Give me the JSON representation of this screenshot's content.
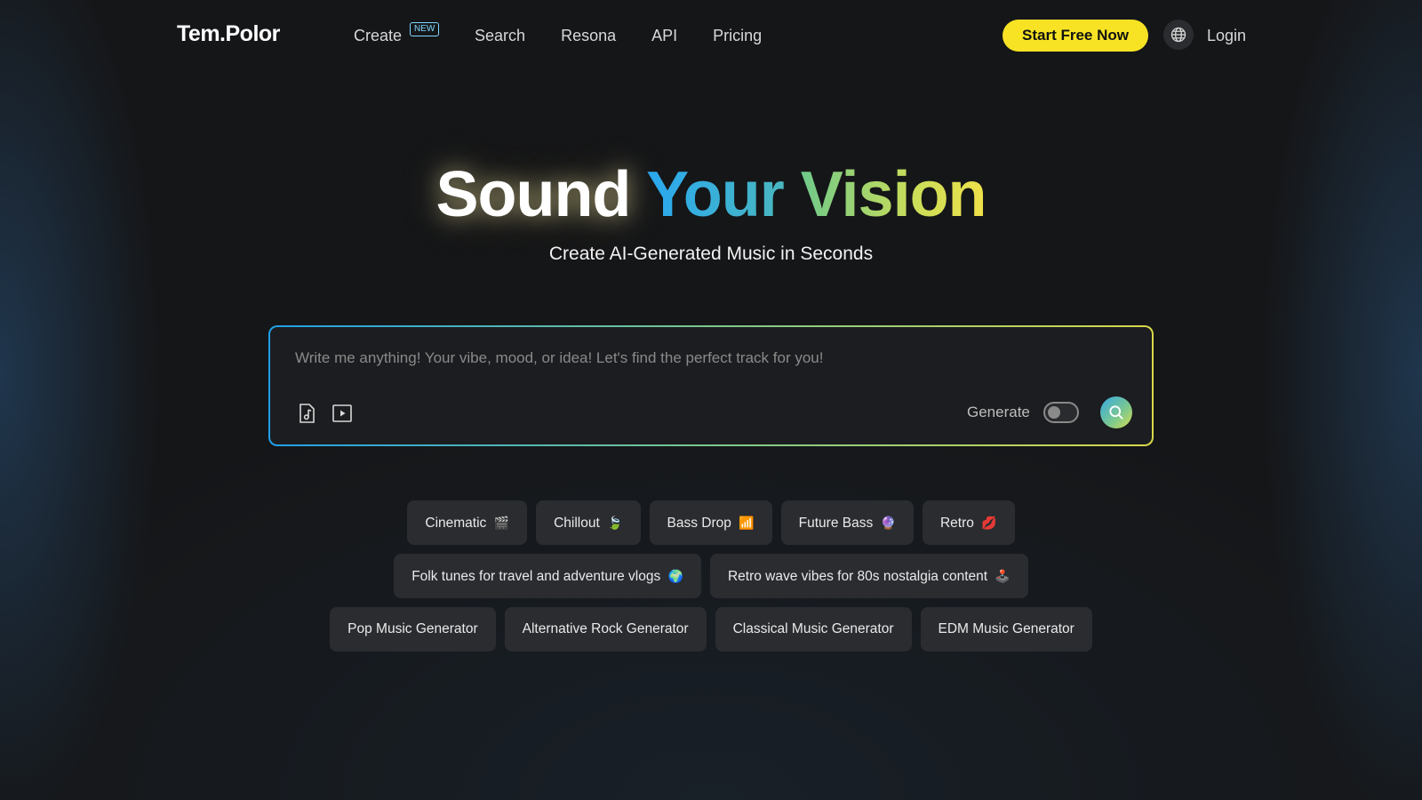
{
  "header": {
    "logo": "Tem.Polor",
    "nav": [
      {
        "label": "Create",
        "badge": "NEW"
      },
      {
        "label": "Search"
      },
      {
        "label": "Resona"
      },
      {
        "label": "API"
      },
      {
        "label": "Pricing"
      }
    ],
    "cta_label": "Start Free Now",
    "globe_icon": "globe-icon",
    "login_label": "Login"
  },
  "hero": {
    "title_words": [
      "Sound",
      "Your",
      "Vision"
    ],
    "subtitle": "Create AI-Generated Music in Seconds"
  },
  "prompt": {
    "placeholder": "Write me anything! Your vibe, mood, or idea! Let's find the perfect track for you!",
    "value": "",
    "audio_icon": "audio-file-icon",
    "video_icon": "video-play-icon",
    "generate_label": "Generate",
    "generate_on": false,
    "search_icon": "search-icon"
  },
  "chips": {
    "row1": [
      {
        "label": "Cinematic",
        "emoji": "🎬"
      },
      {
        "label": "Chillout",
        "emoji": "🍃"
      },
      {
        "label": "Bass Drop",
        "emoji": "📶"
      },
      {
        "label": "Future Bass",
        "emoji": "🔮"
      },
      {
        "label": "Retro",
        "emoji": "💋"
      }
    ],
    "row2": [
      {
        "label": "Folk tunes for travel and adventure vlogs",
        "emoji": "🌍"
      },
      {
        "label": "Retro wave vibes for 80s nostalgia content",
        "emoji": "🕹️"
      }
    ],
    "row3": [
      {
        "label": "Pop Music Generator"
      },
      {
        "label": "Alternative Rock Generator"
      },
      {
        "label": "Classical Music Generator"
      },
      {
        "label": "EDM Music Generator"
      }
    ]
  },
  "colors": {
    "background": "#151618",
    "accent_yellow": "#f7e324",
    "accent_blue": "#2aa8f0",
    "accent_green": "#6fc98a",
    "chip_bg": "#2a2c30"
  }
}
